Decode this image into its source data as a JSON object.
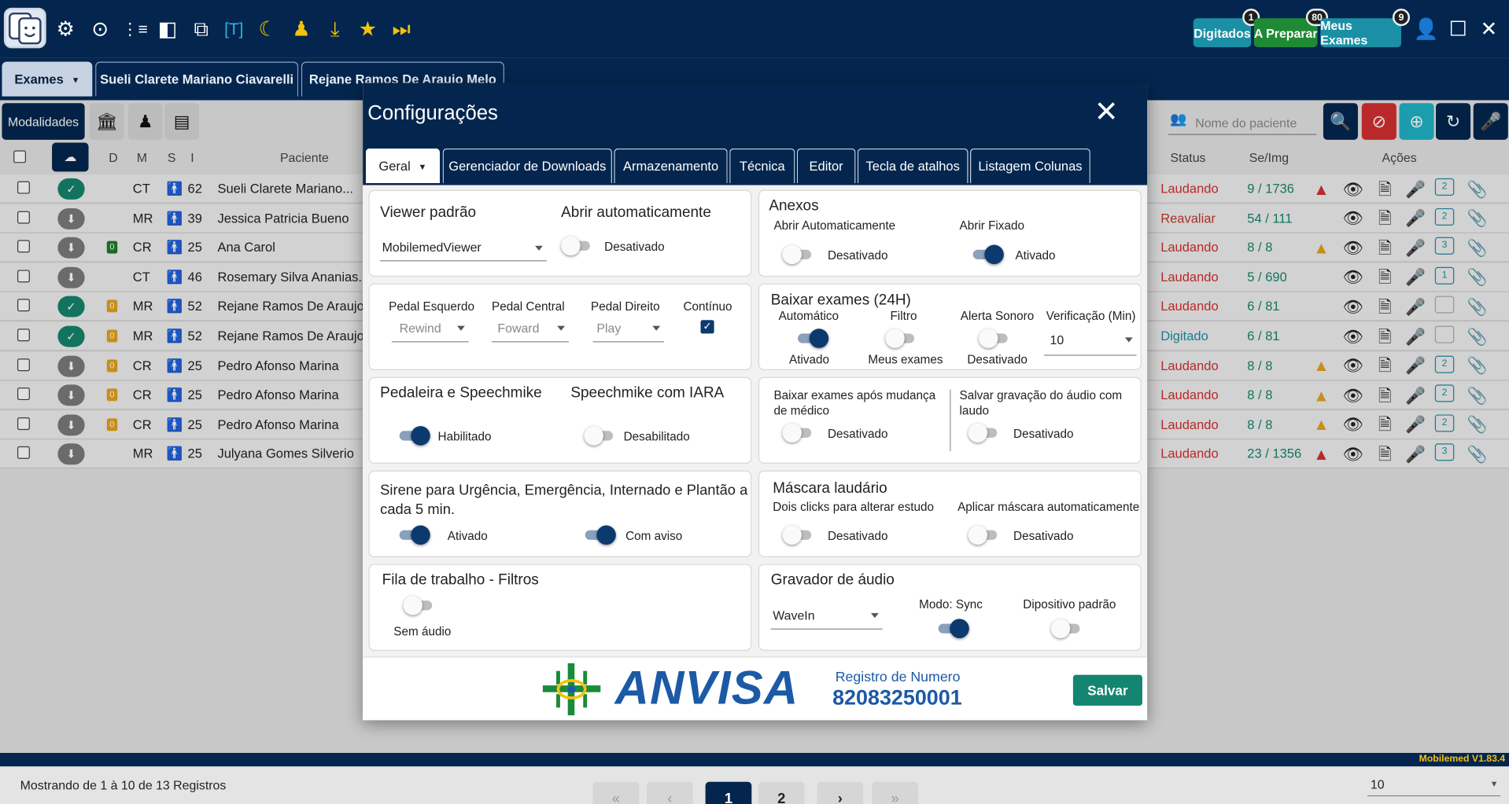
{
  "topbar": {
    "pills": [
      {
        "label": "Digitados",
        "badge": "1"
      },
      {
        "label": "A Preparar",
        "badge": "80"
      },
      {
        "label": "Meus Exames",
        "badge": "9"
      }
    ]
  },
  "tabs": {
    "exames_label": "Exames",
    "patient_tabs": [
      "Sueli Clarete Mariano Ciavarelli",
      "Rejane Ramos De Araujo  Melo"
    ]
  },
  "filterbar": {
    "modalidades_label": "Modalidades",
    "search_placeholder": "Nome do paciente"
  },
  "table": {
    "headers": {
      "d": "D",
      "m": "M",
      "s": "S",
      "i": "I",
      "paciente": "Paciente",
      "status": "Status",
      "seimg": "Se/Img",
      "acoes": "Ações"
    },
    "rows": [
      {
        "mod": "CT",
        "age": "62",
        "name": "Sueli Clarete Mariano...",
        "status": "Laudando",
        "seimg": "9 / 1736",
        "d": ""
      },
      {
        "mod": "MR",
        "age": "39",
        "name": "Jessica Patricia Bueno",
        "status": "Reavaliar",
        "seimg": "54 / 111",
        "d": ""
      },
      {
        "mod": "CR",
        "age": "25",
        "name": "Ana Carol",
        "status": "Laudando",
        "seimg": "8 / 8",
        "d": "0"
      },
      {
        "mod": "CT",
        "age": "46",
        "name": "Rosemary Silva Ananias...",
        "status": "Laudando",
        "seimg": "5 / 690",
        "d": ""
      },
      {
        "mod": "MR",
        "age": "52",
        "name": "Rejane Ramos De Araujo...",
        "status": "Laudando",
        "seimg": "6 / 81",
        "d": "0"
      },
      {
        "mod": "MR",
        "age": "52",
        "name": "Rejane Ramos De Araujo...",
        "status": "Digitado",
        "seimg": "6 / 81",
        "d": "0"
      },
      {
        "mod": "CR",
        "age": "25",
        "name": "Pedro Afonso Marina",
        "status": "Laudando",
        "seimg": "8 / 8",
        "d": "0"
      },
      {
        "mod": "CR",
        "age": "25",
        "name": "Pedro Afonso Marina",
        "status": "Laudando",
        "seimg": "8 / 8",
        "d": "0"
      },
      {
        "mod": "CR",
        "age": "25",
        "name": "Pedro Afonso Marina",
        "status": "Laudando",
        "seimg": "8 / 8",
        "d": "0"
      },
      {
        "mod": "MR",
        "age": "25",
        "name": "Julyana Gomes Silverio",
        "status": "Laudando",
        "seimg": "23 / 1356",
        "d": ""
      }
    ],
    "comment_counts": [
      "2",
      "2",
      "3",
      "1",
      "",
      "",
      "2",
      "2",
      "2",
      "3"
    ]
  },
  "footer": {
    "showing": "Mostrando de 1 à 10  de 13 Registros",
    "pages": [
      "«",
      "‹",
      "1",
      "2",
      "›",
      "»"
    ],
    "page_size": "10",
    "version": "Mobilemed V1.83.4"
  },
  "modal": {
    "title": "Configurações",
    "tabs": [
      "Geral",
      "Gerenciador de Downloads",
      "Armazenamento",
      "Técnica",
      "Editor",
      "Tecla de atalhos",
      "Listagem Colunas"
    ],
    "viewer": {
      "title": "Viewer padrão",
      "value": "MobilemedViewer",
      "auto_title": "Abrir automaticamente",
      "auto_state": "Desativado"
    },
    "anexos": {
      "title": "Anexos",
      "auto_label": "Abrir Automaticamente",
      "auto_state": "Desativado",
      "fixed_label": "Abrir Fixado",
      "fixed_state": "Ativado"
    },
    "pedal": {
      "left_label": "Pedal Esquerdo",
      "left_value": "Rewind",
      "center_label": "Pedal Central",
      "center_value": "Foward",
      "right_label": "Pedal Direito",
      "right_value": "Play",
      "continuous_label": "Contínuo"
    },
    "baixar": {
      "title": "Baixar exames (24H)",
      "auto_label": "Automático",
      "auto_state": "Ativado",
      "filter_label": "Filtro",
      "filter_state": "Meus exames",
      "alert_label": "Alerta Sonoro",
      "alert_state": "Desativado",
      "verif_label": "Verificação (Min)",
      "verif_value": "10"
    },
    "speech": {
      "title": "Pedaleira e Speechmike",
      "state": "Habilitado",
      "iara_title": "Speechmike com IARA",
      "iara_state": "Desabilitado"
    },
    "mudanca": {
      "label": "Baixar exames após mudança de médico",
      "state": "Desativado",
      "audio_label": "Salvar gravação do áudio com laudo",
      "audio_state": "Desativado"
    },
    "sirene": {
      "title": "Sirene para Urgência, Emergência, Internado e Plantão a cada 5 min.",
      "state": "Ativado",
      "aviso_state": "Com aviso"
    },
    "mascara": {
      "title": "Máscara laudário",
      "dois_label": "Dois clicks para alterar estudo",
      "dois_state": "Desativado",
      "aplicar_label": "Aplicar máscara automaticamente",
      "aplicar_state": "Desativado"
    },
    "fila": {
      "title": "Fila de trabalho - Filtros",
      "state": "Sem áudio"
    },
    "gravador": {
      "title": "Gravador de áudio",
      "value": "WaveIn",
      "sync_label": "Modo: Sync",
      "device_label": "Dipositivo padrão"
    },
    "anvisa": {
      "name": "ANVISA",
      "reg_label": "Registro de Numero",
      "reg_number": "82083250001"
    },
    "save_label": "Salvar"
  },
  "colors": {
    "navy": "#04264e",
    "green": "#138571",
    "red": "#d32f2f",
    "cyan": "#27b6e0"
  }
}
